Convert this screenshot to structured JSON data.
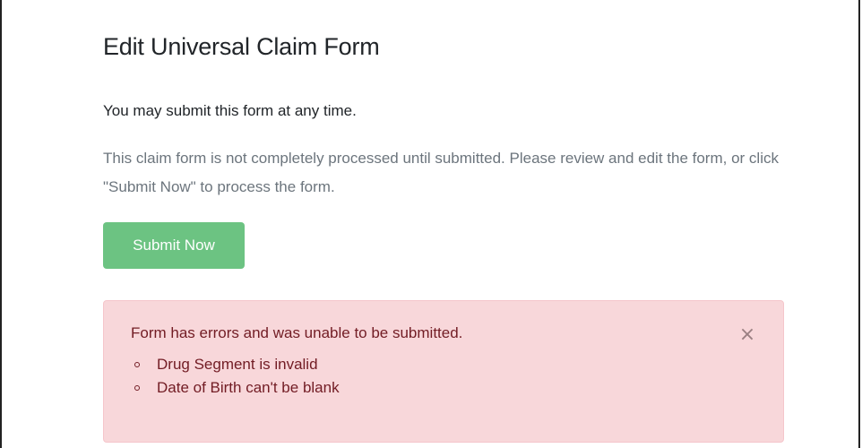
{
  "page": {
    "title": "Edit Universal Claim Form",
    "lead_text": "You may submit this form at any time.",
    "info_text": "This claim form is not completely processed until submitted. Please review and edit the form, or click \"Submit Now\" to process the form.",
    "submit_label": "Submit Now"
  },
  "alert": {
    "message": "Form has errors and was unable to be submitted.",
    "errors": [
      "Drug Segment is invalid",
      "Date of Birth can't be blank"
    ],
    "close_icon": "×"
  },
  "colors": {
    "submit_button": "#6cc382",
    "alert_background": "#f8d7da",
    "alert_text": "#721c24",
    "muted_text": "#6c757d"
  }
}
